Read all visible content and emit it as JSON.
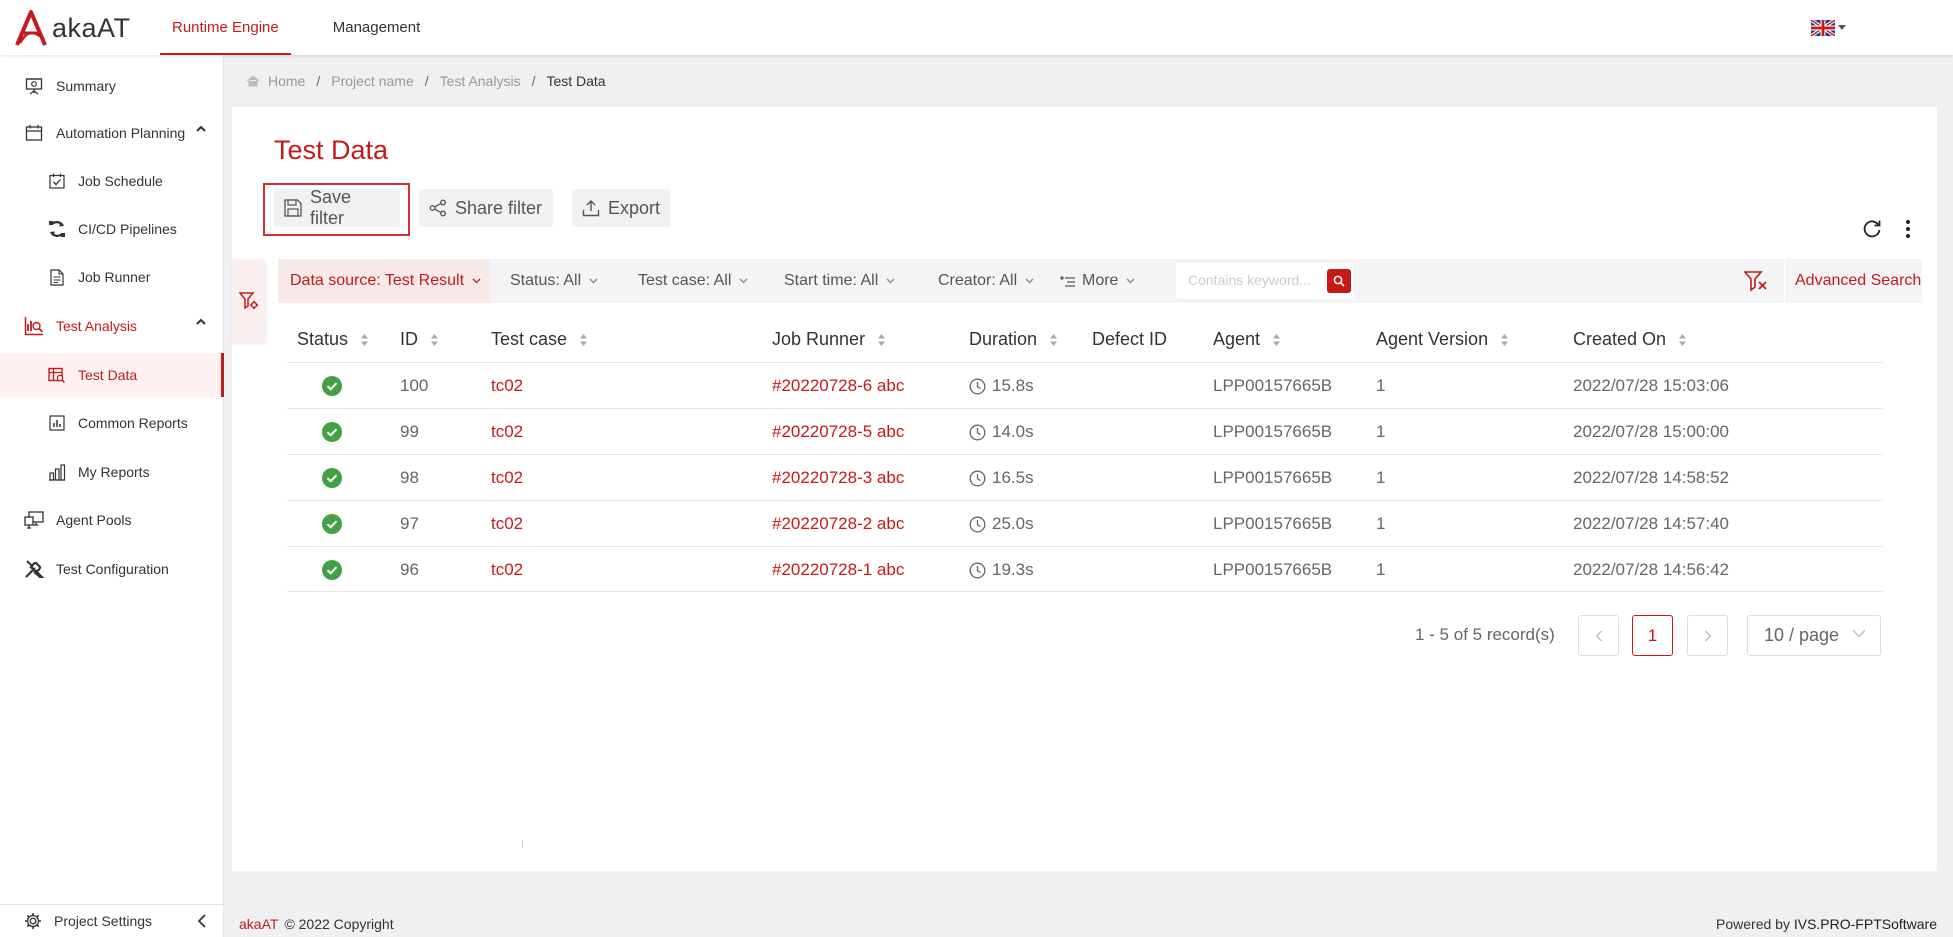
{
  "app": {
    "logo_main": "aka",
    "logo_suffix": "AT",
    "brand_color": "#c41a1a"
  },
  "topnav": {
    "items": [
      {
        "label": "Runtime Engine",
        "active": true
      },
      {
        "label": "Management",
        "active": false
      }
    ],
    "language_icon": "uk-flag-icon"
  },
  "sidebar": {
    "items": [
      {
        "label": "Summary",
        "icon": "presentation-icon"
      },
      {
        "label": "Automation Planning",
        "icon": "calendar-icon",
        "expanded": true
      },
      {
        "label": "Job Schedule",
        "icon": "calendar-check-icon"
      },
      {
        "label": "CI/CD Pipelines",
        "icon": "pipeline-icon"
      },
      {
        "label": "Job Runner",
        "icon": "document-icon"
      },
      {
        "label": "Test Analysis",
        "icon": "analysis-icon",
        "expanded": true
      },
      {
        "label": "Test Data",
        "icon": "table-search-icon",
        "active": true
      },
      {
        "label": "Common Reports",
        "icon": "bar-chart-icon"
      },
      {
        "label": "My Reports",
        "icon": "bar-chart-icon"
      },
      {
        "label": "Agent Pools",
        "icon": "monitor-icon"
      },
      {
        "label": "Test Configuration",
        "icon": "tools-icon"
      }
    ],
    "bottom": {
      "label": "Project Settings",
      "icon": "gear-icon"
    }
  },
  "breadcrumb": {
    "items": [
      "Home",
      "Project name",
      "Test Analysis",
      "Test Data"
    ]
  },
  "page": {
    "title": "Test Data",
    "buttons": {
      "save_filter": "Save filter",
      "share_filter": "Share filter",
      "export": "Export"
    }
  },
  "filters": {
    "data_source": "Data source: Test Result",
    "status": "Status: All",
    "test_case": "Test case: All",
    "start_time": "Start time: All",
    "creator": "Creator: All",
    "more": "More",
    "search_placeholder": "Contains keyword...",
    "advanced_search": "Advanced Search"
  },
  "table": {
    "columns": [
      "Status",
      "ID",
      "Test case",
      "Job Runner",
      "Duration",
      "Defect ID",
      "Agent",
      "Agent Version",
      "Created On"
    ],
    "rows": [
      {
        "status": "passed",
        "id": "100",
        "test_case": "tc02",
        "job_runner": "#20220728-6 abc",
        "duration": "15.8s",
        "defect_id": "",
        "agent": "LPP00157665B",
        "agent_version": "1",
        "created_on": "2022/07/28 15:03:06"
      },
      {
        "status": "passed",
        "id": "99",
        "test_case": "tc02",
        "job_runner": "#20220728-5 abc",
        "duration": "14.0s",
        "defect_id": "",
        "agent": "LPP00157665B",
        "agent_version": "1",
        "created_on": "2022/07/28 15:00:00"
      },
      {
        "status": "passed",
        "id": "98",
        "test_case": "tc02",
        "job_runner": "#20220728-3 abc",
        "duration": "16.5s",
        "defect_id": "",
        "agent": "LPP00157665B",
        "agent_version": "1",
        "created_on": "2022/07/28 14:58:52"
      },
      {
        "status": "passed",
        "id": "97",
        "test_case": "tc02",
        "job_runner": "#20220728-2 abc",
        "duration": "25.0s",
        "defect_id": "",
        "agent": "LPP00157665B",
        "agent_version": "1",
        "created_on": "2022/07/28 14:57:40"
      },
      {
        "status": "passed",
        "id": "96",
        "test_case": "tc02",
        "job_runner": "#20220728-1 abc",
        "duration": "19.3s",
        "defect_id": "",
        "agent": "LPP00157665B",
        "agent_version": "1",
        "created_on": "2022/07/28 14:56:42"
      }
    ]
  },
  "pagination": {
    "info": "1 - 5 of 5 record(s)",
    "current_page": "1",
    "page_size": "10 / page"
  },
  "footer": {
    "brand": "akaAT",
    "copyright": "© 2022 Copyright",
    "powered_prefix": "Powered by",
    "powered_by": "IVS.PRO-FPTSoftware"
  },
  "colors": {
    "accent": "#c41a1a",
    "success": "#43a047"
  }
}
